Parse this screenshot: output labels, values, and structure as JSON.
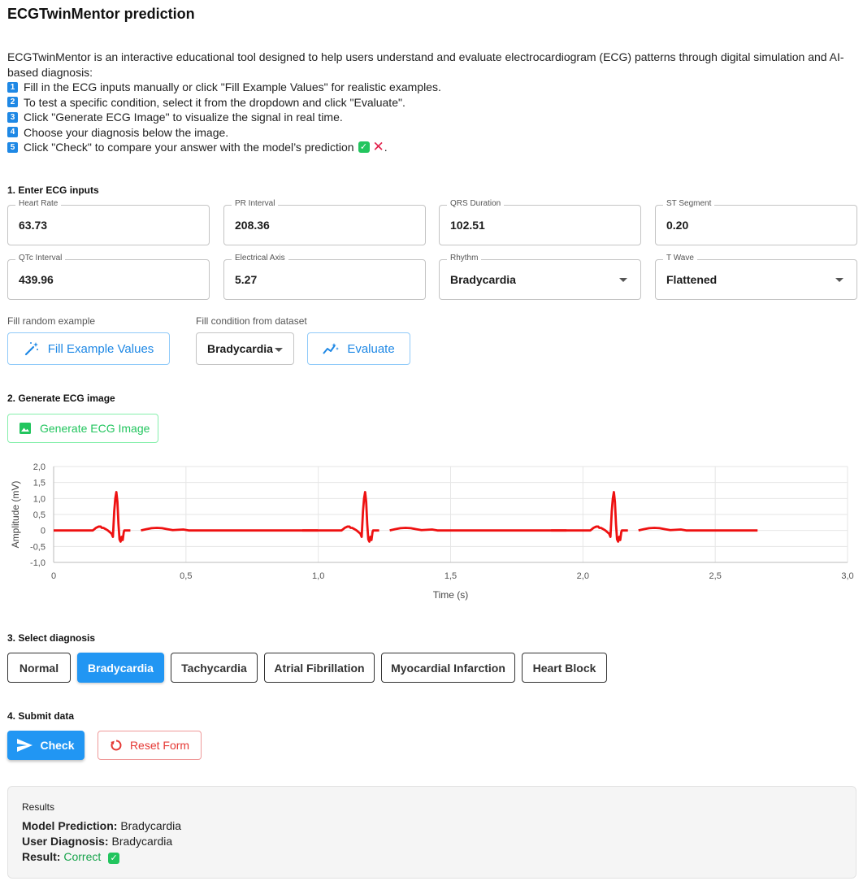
{
  "app": {
    "title": "ECGTwinMentor prediction"
  },
  "intro": {
    "description": "ECGTwinMentor is an interactive educational tool designed to help users understand and evaluate electrocardiogram (ECG) patterns through digital simulation and AI-based diagnosis:",
    "steps": [
      {
        "num": "1",
        "text": "Fill in the ECG inputs manually or click \"Fill Example Values\" for realistic examples."
      },
      {
        "num": "2",
        "text": "To test a specific condition, select it from the dropdown and click \"Evaluate\"."
      },
      {
        "num": "3",
        "text": "Click \"Generate ECG Image\" to visualize the signal in real time."
      },
      {
        "num": "4",
        "text": "Choose your diagnosis below the image."
      },
      {
        "num": "5",
        "text": "Click \"Check\" to compare your answer with the model’s prediction"
      }
    ],
    "step5_suffix": "."
  },
  "sections": {
    "s1": "1. Enter ECG inputs",
    "s2": "2. Generate ECG image",
    "s3": "3. Select diagnosis",
    "s4": "4. Submit data"
  },
  "inputs": {
    "heart_rate": {
      "label": "Heart Rate",
      "value": "63.73"
    },
    "pr_interval": {
      "label": "PR Interval",
      "value": "208.36"
    },
    "qrs_duration": {
      "label": "QRS Duration",
      "value": "102.51"
    },
    "st_segment": {
      "label": "ST Segment",
      "value": "0.20"
    },
    "qtc_interval": {
      "label": "QTc Interval",
      "value": "439.96"
    },
    "electrical_axis": {
      "label": "Electrical Axis",
      "value": "5.27"
    },
    "rhythm": {
      "label": "Rhythm",
      "value": "Bradycardia"
    },
    "t_wave": {
      "label": "T Wave",
      "value": "Flattened"
    }
  },
  "controls": {
    "random_label": "Fill random example",
    "fill_button": "Fill Example Values",
    "dataset_label": "Fill condition from dataset",
    "dataset_select": "Bradycardia",
    "evaluate_button": "Evaluate",
    "generate_button": "Generate ECG Image"
  },
  "chart_data": {
    "type": "line",
    "xlabel": "Time (s)",
    "ylabel": "Amplitude (mV)",
    "xlim": [
      0,
      3.0
    ],
    "ylim": [
      -1.0,
      2.0
    ],
    "xticks": [
      "0",
      "0,5",
      "1,0",
      "1,5",
      "2,0",
      "2,5",
      "3,0"
    ],
    "yticks": [
      "2,0",
      "1,5",
      "1,0",
      "0,5",
      "0",
      "-0,5",
      "-1,0"
    ],
    "grid": true,
    "line_color": "#ee1111",
    "beat_starts": [
      0.0,
      0.94,
      1.88
    ],
    "end_time": 2.66,
    "beat_template": {
      "x": [
        0.0,
        0.148,
        0.16,
        0.17,
        0.178,
        0.182,
        0.188,
        0.195,
        0.205,
        0.212,
        0.219,
        0.224,
        0.229,
        0.233,
        0.237,
        0.241,
        0.245,
        0.249,
        0.253,
        0.257,
        0.261,
        0.265,
        0.267,
        0.272,
        0.278,
        0.29
      ],
      "y": [
        0.0,
        0.0,
        0.08,
        0.12,
        0.12,
        0.08,
        0.08,
        0.05,
        0.0,
        -0.05,
        -0.1,
        -0.2,
        0.6,
        1.0,
        1.2,
        0.9,
        0.2,
        -0.28,
        -0.35,
        -0.2,
        -0.3,
        -0.05,
        0.0,
        0.0,
        0.0,
        0.0
      ],
      "gap_after_x": 0.29,
      "t_wave": {
        "x": [
          0.33,
          0.35,
          0.37,
          0.39,
          0.41,
          0.43,
          0.45,
          0.47,
          0.49,
          0.51,
          0.998
        ],
        "y": [
          0.0,
          0.04,
          0.07,
          0.08,
          0.07,
          0.04,
          0.01,
          0.02,
          0.03,
          0.0,
          0.0
        ]
      }
    }
  },
  "diagnosis": {
    "options": [
      "Normal",
      "Bradycardia",
      "Tachycardia",
      "Atrial Fibrillation",
      "Myocardial Infarction",
      "Heart Block"
    ],
    "selected": "Bradycardia"
  },
  "submit": {
    "check_button": "Check",
    "reset_button": "Reset Form"
  },
  "results": {
    "heading": "Results",
    "model_label": "Model Prediction:",
    "model_value": "Bradycardia",
    "user_label": "User Diagnosis:",
    "user_value": "Bradycardia",
    "result_label": "Result:",
    "result_value": "Correct"
  }
}
